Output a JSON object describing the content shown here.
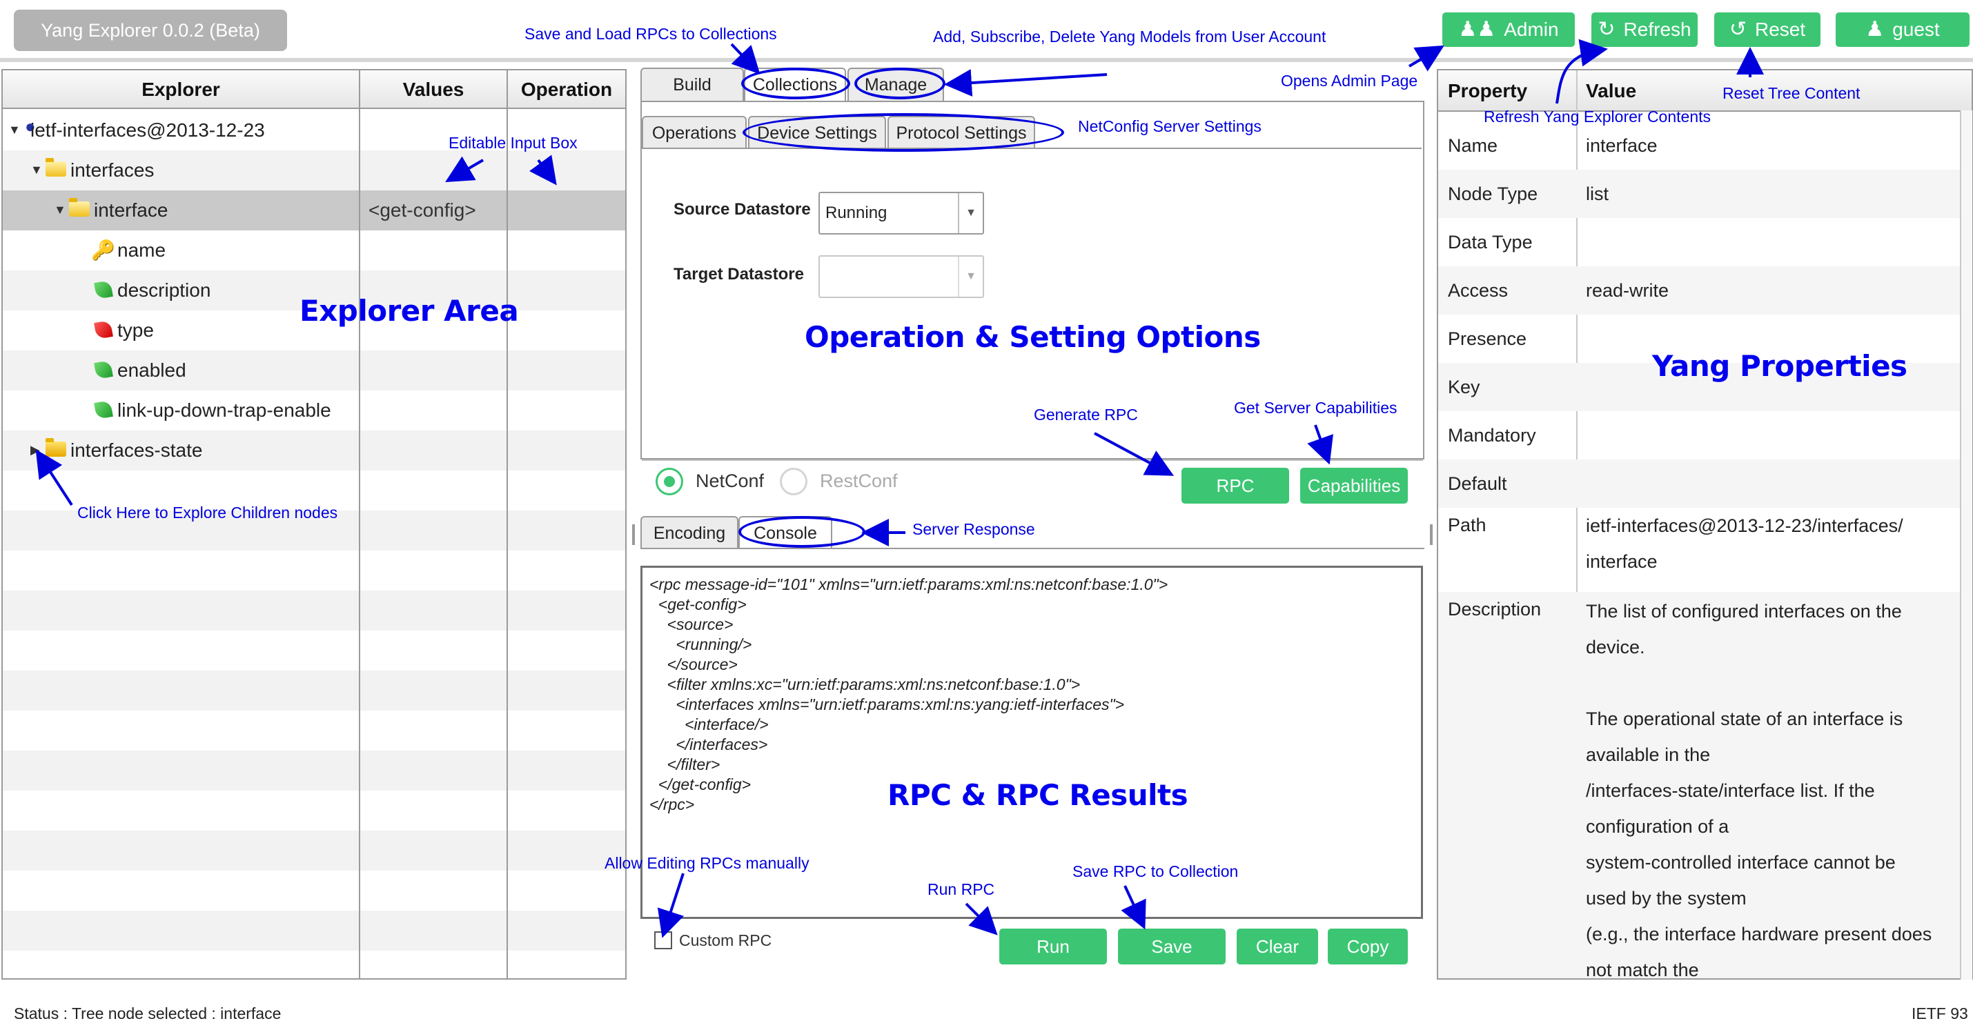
{
  "app": {
    "title": "Yang Explorer 0.0.2 (Beta)"
  },
  "header_buttons": {
    "admin": "Admin",
    "refresh": "Refresh",
    "reset": "Reset",
    "user": "guest"
  },
  "explorer": {
    "columns": [
      "Explorer",
      "Values",
      "Operation"
    ],
    "rows": [
      {
        "label": "ietf-interfaces@2013-12-23",
        "value": ""
      },
      {
        "label": "interfaces",
        "value": ""
      },
      {
        "label": "interface",
        "value": "<get-config>"
      },
      {
        "label": "name",
        "value": ""
      },
      {
        "label": "description",
        "value": ""
      },
      {
        "label": "type",
        "value": ""
      },
      {
        "label": "enabled",
        "value": ""
      },
      {
        "label": "link-up-down-trap-enable",
        "value": ""
      },
      {
        "label": "interfaces-state",
        "value": ""
      }
    ]
  },
  "middle": {
    "main_tabs": [
      "Build",
      "Collections",
      "Manage"
    ],
    "sub_tabs": [
      "Operations",
      "Device Settings",
      "Protocol Settings"
    ],
    "source_label": "Source Datastore",
    "source_value": "Running",
    "target_label": "Target Datastore",
    "target_value": "",
    "protocols": [
      "NetConf",
      "RestConf"
    ],
    "rpc_button": "RPC",
    "capabilities_button": "Capabilities",
    "lower_tabs": [
      "Encoding",
      "Console"
    ],
    "console_text": "<rpc message-id=\"101\" xmlns=\"urn:ietf:params:xml:ns:netconf:base:1.0\">\n  <get-config>\n    <source>\n      <running/>\n    </source>\n    <filter xmlns:xc=\"urn:ietf:params:xml:ns:netconf:base:1.0\">\n      <interfaces xmlns=\"urn:ietf:params:xml:ns:yang:ietf-interfaces\">\n        <interface/>\n      </interfaces>\n    </filter>\n  </get-config>\n</rpc>",
    "custom_rpc_label": "Custom RPC",
    "action_buttons": [
      "Run",
      "Save",
      "Clear",
      "Copy"
    ]
  },
  "properties": {
    "columns": [
      "Property",
      "Value"
    ],
    "rows": [
      {
        "name": "Name",
        "value": "interface"
      },
      {
        "name": "Node Type",
        "value": "list"
      },
      {
        "name": "Data Type",
        "value": ""
      },
      {
        "name": "Access",
        "value": "read-write"
      },
      {
        "name": "Presence",
        "value": ""
      },
      {
        "name": "Key",
        "value": ""
      },
      {
        "name": "Mandatory",
        "value": ""
      },
      {
        "name": "Default",
        "value": ""
      },
      {
        "name": "Path",
        "value": "ietf-interfaces@2013-12-23/interfaces/\ninterface"
      },
      {
        "name": "Description",
        "value": "The list of configured interfaces on the\ndevice.\n\nThe operational state of an interface is\navailable in the\n/interfaces-state/interface list.  If the\nconfiguration of a\nsystem-controlled interface cannot be\nused by the system\n(e.g., the interface hardware present does\nnot match the"
      }
    ]
  },
  "status": {
    "text": "Status : Tree node selected : interface",
    "right": "IETF 93"
  },
  "annotations": {
    "save_load": "Save and Load RPCs to Collections",
    "add_subscribe": "Add, Subscribe, Delete Yang Models from User Account",
    "opens_admin": "Opens Admin Page",
    "refresh_contents": "Refresh Yang Explorer Contents",
    "reset_tree": "Reset Tree Content",
    "editable_input": "Editable Input Box",
    "netconfig_settings": "NetConfig Server Settings",
    "explorer_area": "Explorer Area",
    "operation_setting": "Operation & Setting Options",
    "yang_properties": "Yang Properties",
    "generate_rpc": "Generate RPC",
    "get_capabilities": "Get Server Capabilities",
    "click_here": "Click Here to Explore Children nodes",
    "server_response": "Server Response",
    "rpc_results": "RPC & RPC Results",
    "allow_editing": "Allow Editing RPCs manually",
    "run_rpc": "Run RPC",
    "save_rpc": "Save RPC to Collection"
  },
  "colors": {
    "accent": "#3cc674",
    "annotation": "#0000dd",
    "title_bar": "#b3b3b3"
  },
  "icons": [
    "users-icon",
    "refresh-icon",
    "reset-icon",
    "user-icon",
    "module-icon",
    "folder-icon",
    "key-icon",
    "leaf-icon",
    "expand-triangle-icon",
    "dropdown-arrow-icon"
  ]
}
